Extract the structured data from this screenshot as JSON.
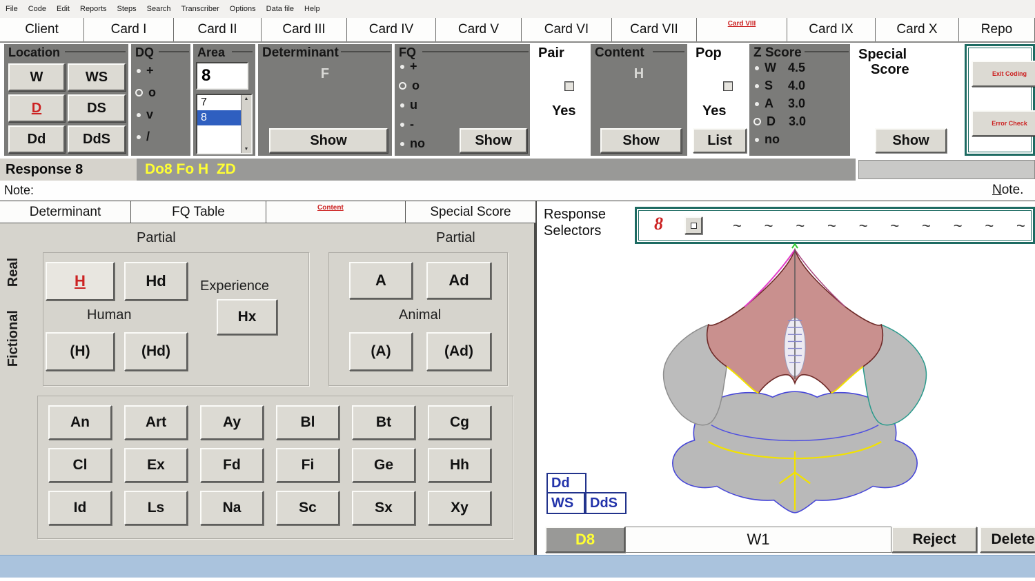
{
  "colors": {
    "panel_gray": "#7b7b79",
    "accent_teal": "#1d6b62",
    "highlight_yellow": "#ffff33",
    "alert_red": "#cc2222",
    "selection_blue": "#2f5fc0",
    "bottom_strip_blue": "#aac3dd"
  },
  "menu_items": [
    "File",
    "Code",
    "Edit",
    "Reports",
    "Steps",
    "Search",
    "Transcriber",
    "Options",
    "Data file",
    "Help"
  ],
  "card_tabs": {
    "items": [
      "Client",
      "Card I",
      "Card II",
      "Card III",
      "Card IV",
      "Card V",
      "Card VI",
      "Card VII",
      "Card VIII",
      "Card IX",
      "Card X",
      "Repo"
    ],
    "active": "Card VIII"
  },
  "coding": {
    "location": {
      "title": "Location",
      "w": "W",
      "ws": "WS",
      "d": "D",
      "ds": "DS",
      "dd": "Dd",
      "dds": "DdS",
      "selected": "D"
    },
    "dq": {
      "title": "DQ",
      "opt1": "+",
      "opt2": "o",
      "opt3": "v",
      "opt4": "/",
      "selected": "o"
    },
    "area": {
      "title": "Area",
      "value": "8",
      "item1": "7",
      "item2": "8",
      "selected": "8"
    },
    "determinant": {
      "title": "Determinant",
      "value": "F",
      "show": "Show"
    },
    "fq": {
      "title": "FQ",
      "opt1": "+",
      "opt2": "o",
      "opt3": "u",
      "opt4": "-",
      "opt5": "no",
      "selected": "o",
      "show": "Show"
    },
    "pair": {
      "title": "Pair",
      "yes": "Yes",
      "checked": false
    },
    "content": {
      "title": "Content",
      "value": "H",
      "show": "Show"
    },
    "pop": {
      "title": "Pop",
      "yes": "Yes",
      "list": "List",
      "checked": false
    },
    "zscore": {
      "title": "Z Score",
      "w_label": "W",
      "w_value": "4.5",
      "s_label": "S",
      "s_value": "4.0",
      "a_label": "A",
      "a_value": "3.0",
      "d_label": "D",
      "d_value": "3.0",
      "no_label": "no",
      "selected": "D"
    },
    "special": {
      "line1": "Special",
      "line2": "Score",
      "show": "Show"
    },
    "side": {
      "exit": "Exit Coding",
      "error": "Error Check"
    }
  },
  "response_bar": {
    "label": "Response 8",
    "code": "Do8 Fo H  ZD"
  },
  "note_bar": {
    "label": "Note:",
    "link": "Note."
  },
  "lower_tabs": {
    "tab1": "Determinant",
    "tab2": "FQ Table",
    "tab3": "Content",
    "tab4": "Special Score"
  },
  "content_panel": {
    "real": "Real",
    "fictional": "Fictional",
    "partial_human": "Partial",
    "partial_animal": "Partial",
    "h": "H",
    "hd": "Hd",
    "experience": "Experience",
    "hx": "Hx",
    "human": "Human",
    "ph": "(H)",
    "phd": "(Hd)",
    "a": "A",
    "ad": "Ad",
    "animal": "Animal",
    "pa": "(A)",
    "pad": "(Ad)",
    "grid": [
      "An",
      "Art",
      "Ay",
      "Bl",
      "Bt",
      "Cg",
      "Cl",
      "Ex",
      "Fd",
      "Fi",
      "Ge",
      "Hh",
      "Id",
      "Ls",
      "Na",
      "Sc",
      "Sx",
      "Xy"
    ],
    "selected": "H"
  },
  "selectors": {
    "line1": "Response",
    "line2": "Selectors",
    "active": "8",
    "tilde": "~"
  },
  "blot": {
    "dd": "Dd",
    "ws": "WS",
    "dds": "DdS"
  },
  "bottom_bar": {
    "location_code": "D8",
    "w_code": "W1",
    "reject": "Reject",
    "delete": "Delete"
  }
}
